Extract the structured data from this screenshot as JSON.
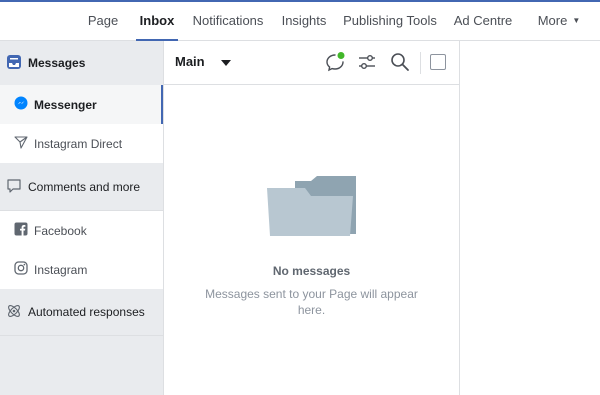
{
  "nav": {
    "tabs": [
      {
        "label": "Page"
      },
      {
        "label": "Inbox"
      },
      {
        "label": "Notifications"
      },
      {
        "label": "Insights"
      },
      {
        "label": "Publishing Tools"
      },
      {
        "label": "Ad Centre"
      },
      {
        "label": "More"
      }
    ],
    "more_caret": "▼"
  },
  "sidebar": {
    "messages_header": "Messages",
    "messenger": "Messenger",
    "instagram_direct": "Instagram Direct",
    "comments_header": "Comments and more",
    "facebook": "Facebook",
    "instagram": "Instagram",
    "automated_header": "Automated responses"
  },
  "toolbar": {
    "folder_label": "Main"
  },
  "empty": {
    "title": "No messages",
    "subtitle": "Messages sent to your Page will appear here."
  },
  "colors": {
    "accent": "#4267b2",
    "online_dot": "#42b72a",
    "folder": "#b8c7d1"
  }
}
